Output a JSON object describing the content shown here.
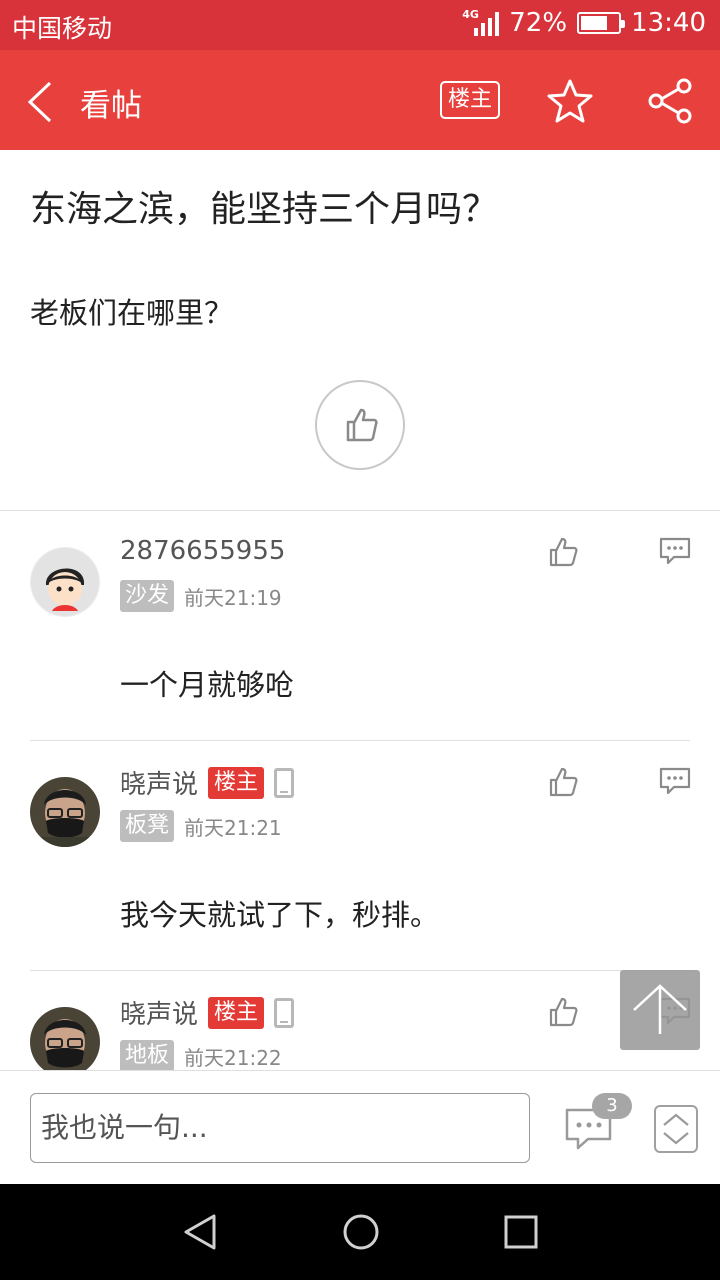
{
  "status_bar": {
    "carrier": "中国移动",
    "network": "4G",
    "battery": "72%",
    "battery_level": 0.72,
    "time": "13:40"
  },
  "app_bar": {
    "title": "看帖",
    "owner_button": "楼主"
  },
  "post": {
    "title": "东海之滨，能坚持三个月吗？",
    "body": "老板们在哪里？"
  },
  "comments": [
    {
      "user": "2876655955",
      "floor": "沙发",
      "time": "前天21:19",
      "text": "一个月就够呛",
      "is_owner": false
    },
    {
      "user": "晓声说",
      "owner_tag": "楼主",
      "floor": "板凳",
      "time": "前天21:21",
      "text": "我今天就试了下，秒排。",
      "is_owner": true
    },
    {
      "user": "晓声说",
      "owner_tag": "楼主",
      "floor": "地板",
      "time": "前天21:22",
      "text": "",
      "is_owner": true
    }
  ],
  "bottom_bar": {
    "input_placeholder": "我也说一句...",
    "comment_count": "3"
  },
  "colors": {
    "brand_red": "#e8413d",
    "status_red": "#d8333a",
    "owner_tag": "#e43a36",
    "floor_tag": "#bdbdbd"
  }
}
